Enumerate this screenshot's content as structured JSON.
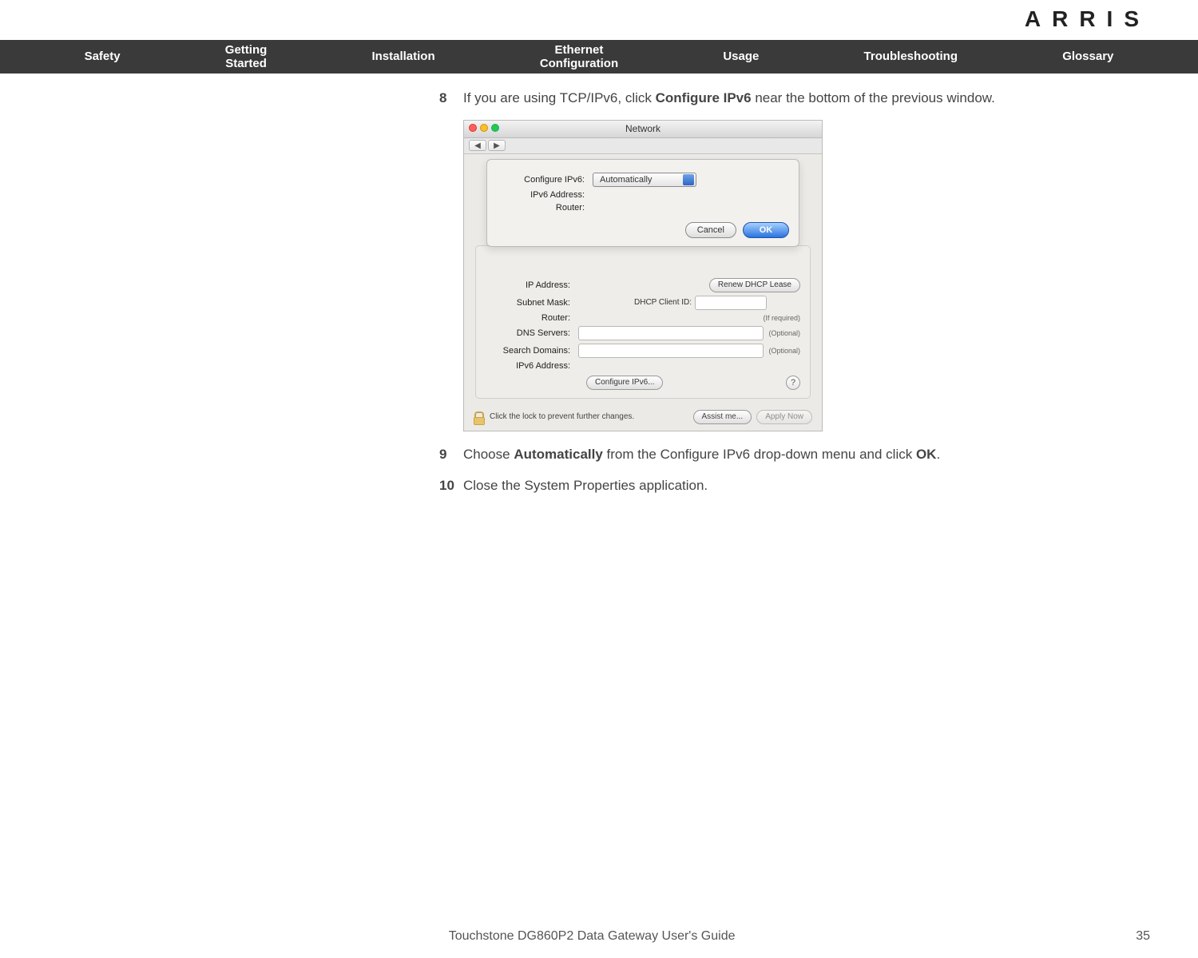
{
  "brand": "ARRIS",
  "nav": {
    "items": [
      {
        "l1": "",
        "l2": "Safety"
      },
      {
        "l1": "Getting",
        "l2": "Started"
      },
      {
        "l1": "",
        "l2": "Installation"
      },
      {
        "l1": "Ethernet",
        "l2": "Configuration"
      },
      {
        "l1": "",
        "l2": "Usage"
      },
      {
        "l1": "",
        "l2": "Troubleshooting"
      },
      {
        "l1": "",
        "l2": "Glossary"
      }
    ]
  },
  "steps": {
    "s8": {
      "num": "8",
      "pre": "If you are using TCP/IPv6, click ",
      "bold": "Configure IPv6",
      "post": " near the bottom of the previous window."
    },
    "s9": {
      "num": "9",
      "pre": "Choose ",
      "bold1": "Automatically",
      "mid": " from the Configure IPv6 drop-down menu and click ",
      "bold2": "OK",
      "post": "."
    },
    "s10": {
      "num": "10",
      "text": "Close the System Properties application."
    }
  },
  "shot": {
    "title": "Network",
    "sheet": {
      "configure_label": "Configure IPv6:",
      "configure_value": "Automatically",
      "ipv6_label": "IPv6 Address:",
      "router_label": "Router:",
      "cancel": "Cancel",
      "ok": "OK"
    },
    "panel": {
      "ip_label": "IP Address:",
      "renew": "Renew DHCP Lease",
      "subnet_label": "Subnet Mask:",
      "dhcp_client_label": "DHCP Client ID:",
      "if_required": "(If required)",
      "router_label": "Router:",
      "dns_label": "DNS Servers:",
      "search_label": "Search Domains:",
      "optional": "(Optional)",
      "ipv6_label": "IPv6 Address:",
      "configure_btn": "Configure IPv6...",
      "help": "?"
    },
    "lock": {
      "text": "Click the lock to prevent further changes.",
      "assist": "Assist me...",
      "apply": "Apply Now"
    }
  },
  "footer": {
    "title": "Touchstone DG860P2 Data Gateway User's Guide",
    "page": "35"
  }
}
